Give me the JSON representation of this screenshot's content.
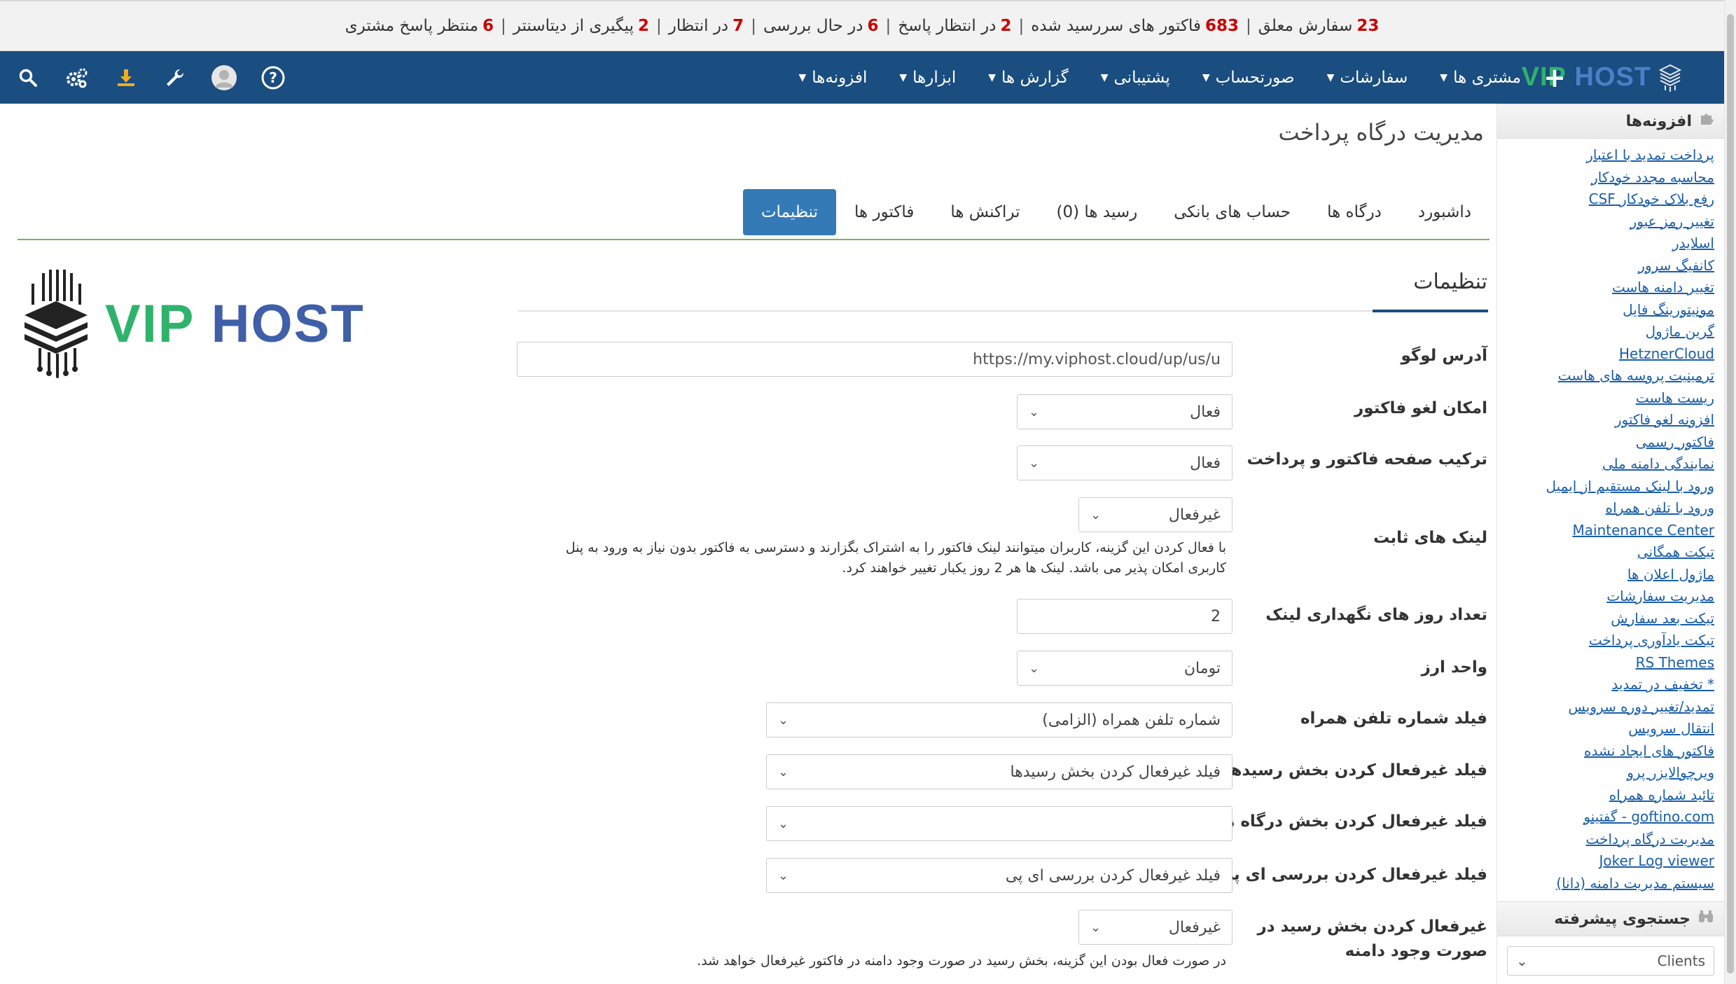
{
  "stats": [
    {
      "num": "23",
      "text": "سفارش معلق"
    },
    {
      "num": "683",
      "text": "فاکتور های سررسید شده"
    },
    {
      "num": "2",
      "text": "در انتظار پاسخ"
    },
    {
      "num": "6",
      "text": "در حال بررسی"
    },
    {
      "num": "7",
      "text": "در انتظار"
    },
    {
      "num": "2",
      "text": "پیگیری از دیتاسنتر"
    },
    {
      "num": "6",
      "text": "منتظر پاسخ مشتری"
    }
  ],
  "brand": {
    "vip": "VIP",
    "host": "HOST"
  },
  "nav": {
    "plus": "+",
    "menu": [
      "مشتری ها",
      "سفارشات",
      "صورتحساب",
      "پشتیبانی",
      "گزارش ها",
      "ابزارها",
      "افزونه‌ها"
    ],
    "icons": [
      "search-icon",
      "gears-icon",
      "download-icon",
      "wrench-icon",
      "user-avatar-icon",
      "help-icon"
    ]
  },
  "sidebar": {
    "addons_title": "افزونه‌ها",
    "items": [
      "پرداخت تمدید با اعتبار",
      "محاسبه مجدد خودکار",
      "رفع بلاک خودکار CSF",
      "تغییر رمز عبور",
      "اسلایدر",
      "کانفیگ سرور",
      "تغییر دامنه هاست",
      "مونیتورینگ فایل",
      "گرین ماژول",
      "HetznerCloud",
      "ترمینیت پروسه های هاست",
      "ریست هاست",
      "افزونه لغو فاکتور",
      "فاکتور رسمی",
      "نمایندگی دامنه ملی",
      "ورود با لینک مستقیم از ایمیل",
      "ورود با تلفن همراه",
      "Maintenance Center",
      "تیکت همگانی",
      "ماژول اعلان ها",
      "مدیریت سفارشات",
      "تیکت بعد سفارش",
      "تیکت یادآوری پرداخت",
      "RS Themes",
      "* تخفیف در تمدید",
      "تمدید/تغییر دوره سرویس",
      "انتقال سرویس",
      "فاکتور های ایجاد نشده",
      "ویرچوالایزر پرو",
      "تائید شماره همراه",
      "goftino.com - گفتینو",
      "مدیریت درگاه پرداخت",
      "Joker Log viewer",
      "سیستم مدیریت دامنه (دانا)"
    ],
    "search_title": "جستجوی پیشرفته",
    "search_select": "Clients"
  },
  "page": {
    "title": "مدیریت درگاه پرداخت",
    "tabs": [
      "داشبورد",
      "درگاه ها",
      "حساب های بانکی",
      "رسید ها (0)",
      "تراکنش ها",
      "فاکتور ها",
      "تنظیمات"
    ],
    "active_tab": "تنظیمات",
    "section_title": "تنظیمات"
  },
  "form": {
    "logo_url_label": "آدرس لوگو",
    "logo_url_value": "https://my.viphost.cloud/up/us/u",
    "cancel_invoice_label": "امکان لغو فاکتور",
    "cancel_invoice_value": "فعال",
    "combine_page_label": "ترکیب صفحه فاکتور و پرداخت",
    "combine_page_value": "فعال",
    "fixed_links_label": "لینک های ثابت",
    "fixed_links_value": "غیرفعال",
    "fixed_links_help": "با فعال کردن این گزینه، کاربران میتوانند لینک فاکتور را به اشتراک بگزارند و دسترسی به فاکتور بدون نیاز به ورود به پنل کاربری امکان پذیر می باشد. لینک ها هر 2 روز یکبار تغییر خواهند کرد.",
    "link_days_label": "تعداد روز های نگهداری لینک",
    "link_days_value": "2",
    "currency_label": "واحد ارز",
    "currency_value": "تومان",
    "phone_field_label": "فیلد شماره تلفن همراه",
    "phone_field_value": "شماره تلفن همراه (الزامی)",
    "disable_receipts_label": "فیلد غیرفعال کردن بخش رسیدها",
    "disable_receipts_value": "فیلد غیرفعال کردن بخش رسیدها",
    "disable_gateways_label": "فیلد غیرفعال کردن بخش درگاه ها",
    "disable_gateways_value": "",
    "disable_ip_label": "فیلد غیرفعال کردن بررسی ای پی",
    "disable_ip_value": "فیلد غیرفعال کردن بررسی ای پی",
    "disable_receipt_domain_label_1": "غیرفعال کردن بخش رسید در",
    "disable_receipt_domain_label_2": "صورت وجود دامنه",
    "disable_receipt_domain_value": "غیرفعال",
    "disable_receipt_domain_help": "در صورت فعال بودن این گزینه، بخش رسید در صورت وجود دامنه در فاکتور غیرفعال خواهد شد."
  },
  "colors": {
    "navbar": "#1a4d80",
    "accent_green": "#77b84a",
    "active_tab": "#337ab7",
    "stat_number": "#cc0000",
    "link": "#1a5ea8"
  }
}
